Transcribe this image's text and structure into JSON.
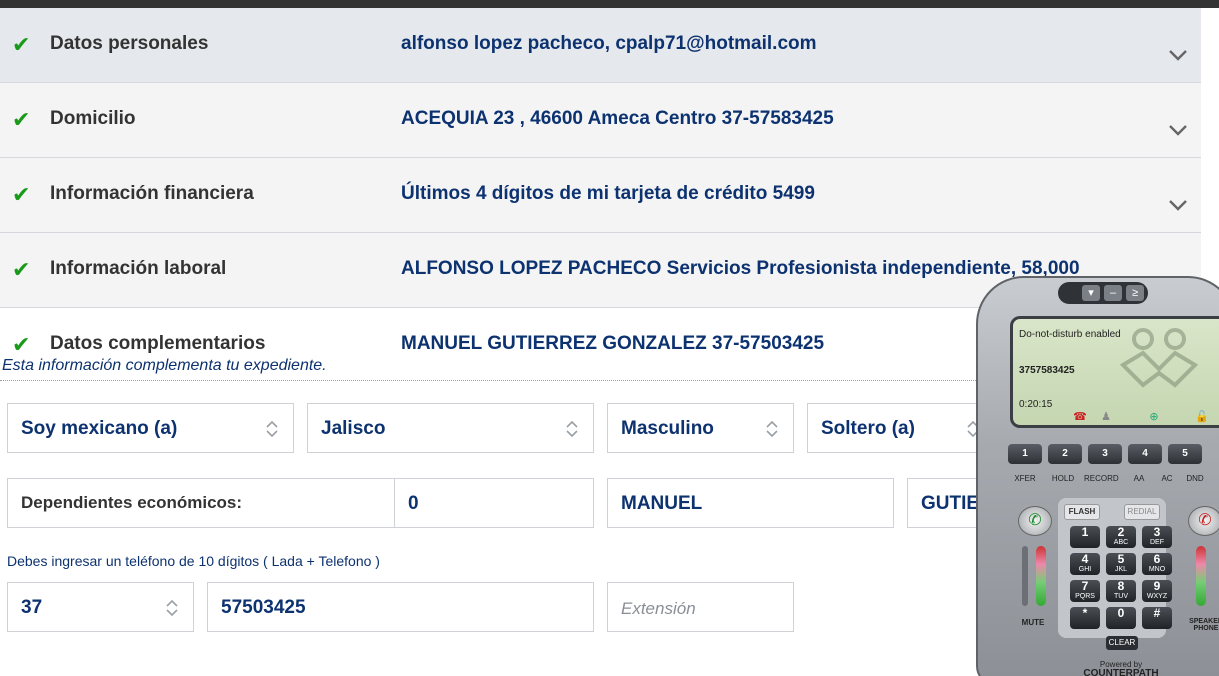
{
  "rows": [
    {
      "label": "Datos personales",
      "value": "alfonso lopez pacheco, cpalp71@hotmail.com"
    },
    {
      "label": "Domicilio",
      "value": "ACEQUIA 23 , 46600 Ameca Centro 37-57583425"
    },
    {
      "label": "Información financiera",
      "value": "Últimos 4 dígitos de mi tarjeta de crédito 5499"
    },
    {
      "label": "Información laboral",
      "value": "ALFONSO LOPEZ PACHECO Servicios Profesionista independiente, 58,000"
    },
    {
      "label": "Datos complementarios",
      "value": "MANUEL GUTIERREZ GONZALEZ 37-57503425"
    }
  ],
  "complement": {
    "note": "Esta información complementa tu expediente.",
    "nationality": "Soy mexicano (a)",
    "state": "Jalisco",
    "gender": "Masculino",
    "marital": "Soltero (a)",
    "dependents_label": "Dependientes económicos:",
    "dependents_value": "0",
    "ref_name": "MANUEL",
    "ref_lastname": "GUTIER",
    "phone_hint": "Debes ingresar un teléfono de 10 dígitos ( Lada + Telefono )",
    "lada": "37",
    "phone": "57503425",
    "extension_placeholder": "Extensión"
  },
  "softphone": {
    "status": "Do-not-disturb enabled",
    "number": "3757583425",
    "timer": "0:20:15",
    "lines": [
      "1",
      "2",
      "3",
      "4",
      "5"
    ],
    "functions": [
      "XFER",
      "HOLD",
      "RECORD",
      "AA",
      "AC",
      "DND"
    ],
    "flash": "FLASH",
    "redial": "REDIAL",
    "keys": [
      {
        "n": "1",
        "l": ""
      },
      {
        "n": "2",
        "l": "ABC"
      },
      {
        "n": "3",
        "l": "DEF"
      },
      {
        "n": "4",
        "l": "GHI"
      },
      {
        "n": "5",
        "l": "JKL"
      },
      {
        "n": "6",
        "l": "MNO"
      },
      {
        "n": "7",
        "l": "PQRS"
      },
      {
        "n": "8",
        "l": "TUV"
      },
      {
        "n": "9",
        "l": "WXYZ"
      },
      {
        "n": "*",
        "l": ""
      },
      {
        "n": "0",
        "l": ""
      },
      {
        "n": "#",
        "l": ""
      }
    ],
    "clear": "CLEAR",
    "mute": "MUTE",
    "speaker": "SPEAKER PHONE",
    "powered": "Powered by",
    "brand": "COUNTERPATH"
  },
  "colors": {
    "check": "#1a9a1a",
    "value_text": "#0d3270",
    "row_bg_active": "#e5e8ec"
  }
}
